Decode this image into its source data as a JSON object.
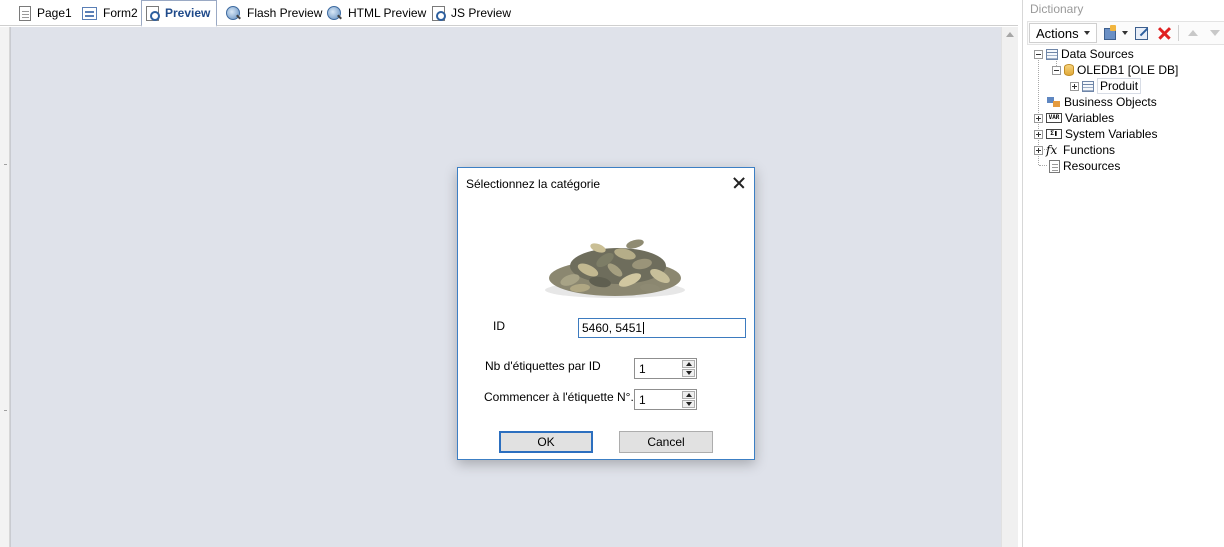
{
  "tabs": [
    {
      "label": "Page1",
      "icon": "page-icon"
    },
    {
      "label": "Form2",
      "icon": "form-icon"
    },
    {
      "label": "Preview",
      "icon": "preview-icon",
      "active": true
    },
    {
      "label": "Flash Preview",
      "icon": "flash-preview-icon"
    },
    {
      "label": "HTML Preview",
      "icon": "html-preview-icon"
    },
    {
      "label": "JS Preview",
      "icon": "js-preview-icon"
    }
  ],
  "dialog": {
    "title": "Sélectionnez la catégorie",
    "image": "pumpkin-seeds-image",
    "id_label": "ID",
    "id_value": "5460, 5451",
    "nb_label": "Nb d'étiquettes par ID",
    "nb_value": "1",
    "start_label": "Commencer à l'étiquette N°...",
    "start_value": "1",
    "ok_label": "OK",
    "cancel_label": "Cancel"
  },
  "dictionary": {
    "header": "Dictionary",
    "actions_label": "Actions",
    "tree": {
      "data_sources": "Data Sources",
      "oledb": "OLEDB1 [OLE DB]",
      "produit": "Produit",
      "business_objects": "Business Objects",
      "variables": "Variables",
      "system_variables": "System Variables",
      "functions": "Functions",
      "resources": "Resources",
      "var_icon_text": "VAR",
      "sysvar_icon_text": "Σ❚",
      "fx_icon_text": "fx"
    }
  },
  "colors": {
    "canvas_bg": "#dfe2ea",
    "dialog_border": "#3c7fc4",
    "active_tab_text": "#1f4a8a",
    "delete_icon": "#e02020"
  }
}
